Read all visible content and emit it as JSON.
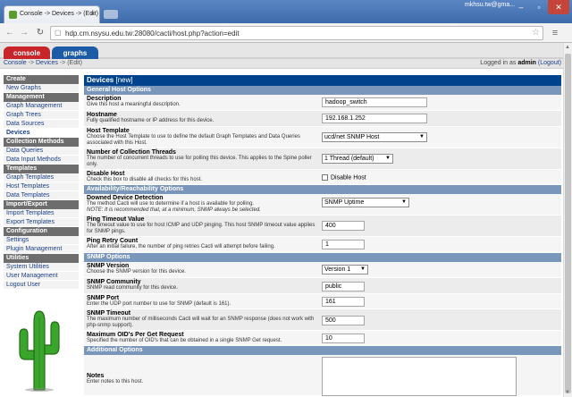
{
  "browser": {
    "tab_title": "Console -> Devices -> (Edit)",
    "profile": "mkhsu.tw@gma...",
    "url": "hdp.cm.nsysu.edu.tw:28080/cacti/host.php?action=edit"
  },
  "cacti": {
    "tabs": [
      "console",
      "graphs"
    ],
    "breadcrumb": [
      "Console",
      "Devices",
      "(Edit)"
    ],
    "logged_in_prefix": "Logged in as",
    "user": "admin",
    "logout": "(Logout)"
  },
  "menu": [
    {
      "header": "Create",
      "items": [
        "New Graphs"
      ]
    },
    {
      "header": "Management",
      "items": [
        "Graph Management",
        "Graph Trees",
        "Data Sources",
        "Devices"
      ]
    },
    {
      "header": "Collection Methods",
      "items": [
        "Data Queries",
        "Data Input Methods"
      ]
    },
    {
      "header": "Templates",
      "items": [
        "Graph Templates",
        "Host Templates",
        "Data Templates"
      ]
    },
    {
      "header": "Import/Export",
      "items": [
        "Import Templates",
        "Export Templates"
      ]
    },
    {
      "header": "Configuration",
      "items": [
        "Settings",
        "Plugin Management"
      ]
    },
    {
      "header": "Utilities",
      "items": [
        "System Utilities",
        "User Management",
        "Logout User"
      ]
    }
  ],
  "form": {
    "title": "Devices",
    "title_suffix": "[new]",
    "sections": {
      "general": "General Host Options",
      "availability": "Availability/Reachability Options",
      "snmp": "SNMP Options",
      "additional": "Additional Options"
    },
    "description": {
      "label": "Description",
      "desc": "Give this host a meaningful description.",
      "value": "hadoop_switch"
    },
    "hostname": {
      "label": "Hostname",
      "desc": "Fully qualified hostname or IP address for this device.",
      "value": "192.168.1.252"
    },
    "host_template": {
      "label": "Host Template",
      "desc": "Choose the Host Template to use to define the default Graph Templates and Data Queries associated with this Host.",
      "value": "ucd/net SNMP Host"
    },
    "threads": {
      "label": "Number of Collection Threads",
      "desc": "The number of concurrent threads to use for polling this device. This applies to the Spine poller only.",
      "value": "1 Thread (default)"
    },
    "disable": {
      "label": "Disable Host",
      "desc": "Check this box to disable all checks for this host.",
      "value": "Disable Host"
    },
    "downed": {
      "label": "Downed Device Detection",
      "desc": "The method Cacti will use to determine if a host is available for polling.",
      "note": "NOTE: It is recommended that, at a minimum, SNMP always be selected.",
      "value": "SNMP Uptime"
    },
    "ping_timeout": {
      "label": "Ping Timeout Value",
      "desc": "The timeout value to use for host ICMP and UDP pinging. This host SNMP timeout value applies for SNMP pings.",
      "value": "400"
    },
    "ping_retry": {
      "label": "Ping Retry Count",
      "desc": "After an initial failure, the number of ping retries Cacti will attempt before failing.",
      "value": "1"
    },
    "snmp_version": {
      "label": "SNMP Version",
      "desc": "Choose the SNMP version for this device.",
      "value": "Version 1"
    },
    "snmp_community": {
      "label": "SNMP Community",
      "desc": "SNMP read community for this device.",
      "value": "public"
    },
    "snmp_port": {
      "label": "SNMP Port",
      "desc": "Enter the UDP port number to use for SNMP (default is 161).",
      "value": "161"
    },
    "snmp_timeout": {
      "label": "SNMP Timeout",
      "desc": "The maximum number of milliseconds Cacti will wait for an SNMP response (does not work with php-snmp support).",
      "value": "500"
    },
    "max_oids": {
      "label": "Maximum OID's Per Get Request",
      "desc": "Specified the number of OID's that can be obtained in a single SNMP Get request.",
      "value": "10"
    },
    "notes": {
      "label": "Notes",
      "desc": "Enter notes to this host."
    }
  }
}
